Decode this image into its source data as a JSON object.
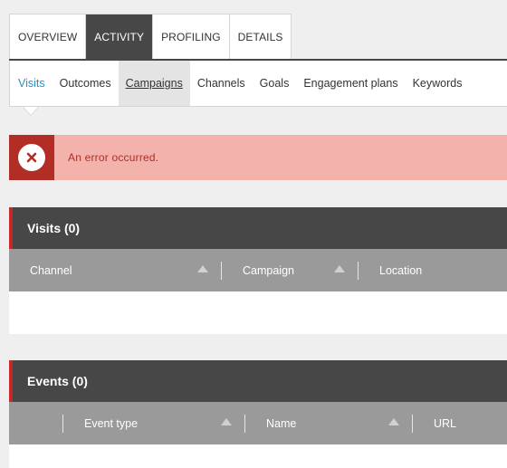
{
  "top_tabs": [
    "OVERVIEW",
    "ACTIVITY",
    "PROFILING",
    "DETAILS"
  ],
  "sub_tabs": [
    "Visits",
    "Outcomes",
    "Campaigns",
    "Channels",
    "Goals",
    "Engagement plans",
    "Keywords"
  ],
  "error": {
    "message": "An error occurred."
  },
  "visits": {
    "title": "Visits (0)",
    "columns": [
      "Channel",
      "Campaign",
      "Location"
    ]
  },
  "events": {
    "title": "Events (0)",
    "columns": [
      "Event type",
      "Name",
      "URL"
    ]
  },
  "colors": {
    "dark": "#474747",
    "accent_red": "#c62828",
    "error_bg": "#f4b2ac",
    "error_icon_bg": "#b12d26",
    "link_blue": "#2a8dc5",
    "column_bar": "#9a9a9a"
  }
}
